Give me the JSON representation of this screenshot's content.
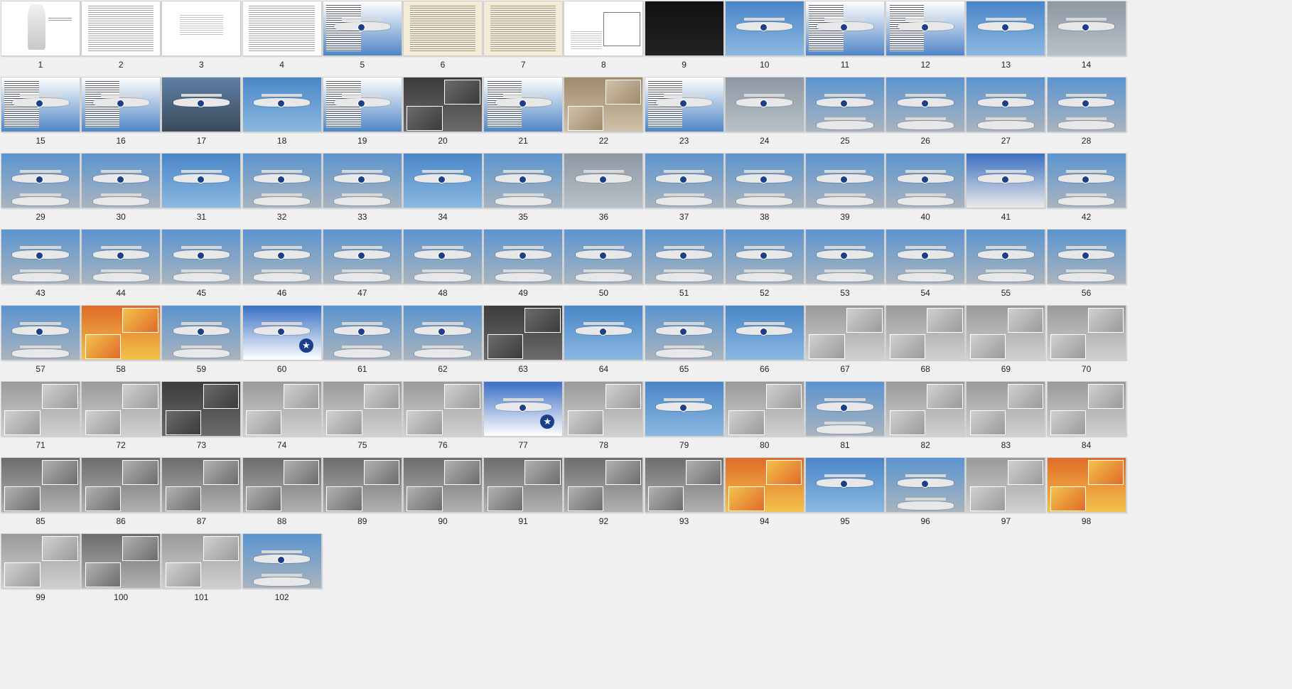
{
  "window": {
    "title": ""
  },
  "thumbnails": [
    {
      "label": "1",
      "kind": "cover"
    },
    {
      "label": "2",
      "kind": "text"
    },
    {
      "label": "3",
      "kind": "title"
    },
    {
      "label": "4",
      "kind": "text"
    },
    {
      "label": "5",
      "kind": "mixed"
    },
    {
      "label": "6",
      "kind": "doc"
    },
    {
      "label": "7",
      "kind": "doc"
    },
    {
      "label": "8",
      "kind": "drawing"
    },
    {
      "label": "9",
      "kind": "dark"
    },
    {
      "label": "10",
      "kind": "sky"
    },
    {
      "label": "11",
      "kind": "mixed"
    },
    {
      "label": "12",
      "kind": "mixed"
    },
    {
      "label": "13",
      "kind": "sky"
    },
    {
      "label": "14",
      "kind": "grey"
    },
    {
      "label": "15",
      "kind": "mixed"
    },
    {
      "label": "16",
      "kind": "mixed"
    },
    {
      "label": "17",
      "kind": "deck"
    },
    {
      "label": "18",
      "kind": "sky"
    },
    {
      "label": "19",
      "kind": "mixed"
    },
    {
      "label": "20",
      "kind": "hangar"
    },
    {
      "label": "21",
      "kind": "mixed"
    },
    {
      "label": "22",
      "kind": "tan"
    },
    {
      "label": "23",
      "kind": "mixed"
    },
    {
      "label": "24",
      "kind": "grey"
    },
    {
      "label": "25",
      "kind": "sky2"
    },
    {
      "label": "26",
      "kind": "sky2"
    },
    {
      "label": "27",
      "kind": "sky2"
    },
    {
      "label": "28",
      "kind": "sky2"
    },
    {
      "label": "29",
      "kind": "sky2"
    },
    {
      "label": "30",
      "kind": "sky2"
    },
    {
      "label": "31",
      "kind": "sky"
    },
    {
      "label": "32",
      "kind": "sky2"
    },
    {
      "label": "33",
      "kind": "sky2"
    },
    {
      "label": "34",
      "kind": "sky"
    },
    {
      "label": "35",
      "kind": "sky2"
    },
    {
      "label": "36",
      "kind": "grey"
    },
    {
      "label": "37",
      "kind": "sky2"
    },
    {
      "label": "38",
      "kind": "sky2"
    },
    {
      "label": "39",
      "kind": "sky2"
    },
    {
      "label": "40",
      "kind": "sky2"
    },
    {
      "label": "41",
      "kind": "nose"
    },
    {
      "label": "42",
      "kind": "sky2"
    },
    {
      "label": "43",
      "kind": "sky2"
    },
    {
      "label": "44",
      "kind": "sky2"
    },
    {
      "label": "45",
      "kind": "sky2"
    },
    {
      "label": "46",
      "kind": "sky2"
    },
    {
      "label": "47",
      "kind": "sky2"
    },
    {
      "label": "48",
      "kind": "sky2"
    },
    {
      "label": "49",
      "kind": "sky2"
    },
    {
      "label": "50",
      "kind": "sky2"
    },
    {
      "label": "51",
      "kind": "sky2"
    },
    {
      "label": "52",
      "kind": "sky2"
    },
    {
      "label": "53",
      "kind": "sky2"
    },
    {
      "label": "54",
      "kind": "sky2"
    },
    {
      "label": "55",
      "kind": "sky2"
    },
    {
      "label": "56",
      "kind": "sky2"
    },
    {
      "label": "57",
      "kind": "sky2"
    },
    {
      "label": "58",
      "kind": "orange"
    },
    {
      "label": "59",
      "kind": "sky2"
    },
    {
      "label": "60",
      "kind": "star"
    },
    {
      "label": "61",
      "kind": "sky2"
    },
    {
      "label": "62",
      "kind": "sky2"
    },
    {
      "label": "63",
      "kind": "hangar"
    },
    {
      "label": "64",
      "kind": "sky"
    },
    {
      "label": "65",
      "kind": "sky2"
    },
    {
      "label": "66",
      "kind": "sky"
    },
    {
      "label": "67",
      "kind": "detail"
    },
    {
      "label": "68",
      "kind": "detail"
    },
    {
      "label": "69",
      "kind": "detail"
    },
    {
      "label": "70",
      "kind": "detail"
    },
    {
      "label": "71",
      "kind": "detail"
    },
    {
      "label": "72",
      "kind": "detail"
    },
    {
      "label": "73",
      "kind": "hangar"
    },
    {
      "label": "74",
      "kind": "detail"
    },
    {
      "label": "75",
      "kind": "detail"
    },
    {
      "label": "76",
      "kind": "detail"
    },
    {
      "label": "77",
      "kind": "star"
    },
    {
      "label": "78",
      "kind": "detail"
    },
    {
      "label": "79",
      "kind": "sky"
    },
    {
      "label": "80",
      "kind": "detail"
    },
    {
      "label": "81",
      "kind": "sky2"
    },
    {
      "label": "82",
      "kind": "detail"
    },
    {
      "label": "83",
      "kind": "detail"
    },
    {
      "label": "84",
      "kind": "detail"
    },
    {
      "label": "85",
      "kind": "cabin"
    },
    {
      "label": "86",
      "kind": "cabin"
    },
    {
      "label": "87",
      "kind": "cabin"
    },
    {
      "label": "88",
      "kind": "cabin"
    },
    {
      "label": "89",
      "kind": "cabin"
    },
    {
      "label": "90",
      "kind": "cabin"
    },
    {
      "label": "91",
      "kind": "cabin"
    },
    {
      "label": "92",
      "kind": "cabin"
    },
    {
      "label": "93",
      "kind": "cabin"
    },
    {
      "label": "94",
      "kind": "orange"
    },
    {
      "label": "95",
      "kind": "sky"
    },
    {
      "label": "96",
      "kind": "sky2"
    },
    {
      "label": "97",
      "kind": "detail"
    },
    {
      "label": "98",
      "kind": "orange"
    },
    {
      "label": "99",
      "kind": "detail"
    },
    {
      "label": "100",
      "kind": "cabin"
    },
    {
      "label": "101",
      "kind": "detail"
    },
    {
      "label": "102",
      "kind": "sky2"
    }
  ]
}
